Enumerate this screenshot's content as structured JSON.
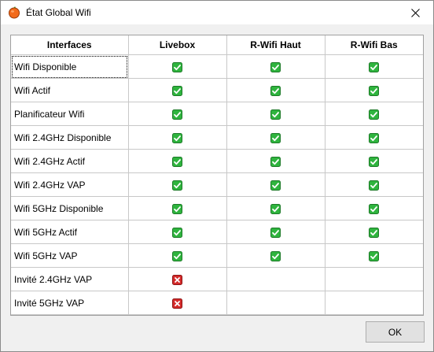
{
  "window": {
    "title": "État Global Wifi",
    "app_icon": "orange-app-icon",
    "close_icon": "close-icon"
  },
  "table": {
    "headers": [
      "Interfaces",
      "Livebox",
      "R-Wifi Haut",
      "R-Wifi Bas"
    ],
    "rows": [
      {
        "label": "Wifi Disponible",
        "values": [
          "ok",
          "ok",
          "ok"
        ]
      },
      {
        "label": "Wifi Actif",
        "values": [
          "ok",
          "ok",
          "ok"
        ]
      },
      {
        "label": "Planificateur Wifi",
        "values": [
          "ok",
          "ok",
          "ok"
        ]
      },
      {
        "label": "Wifi 2.4GHz Disponible",
        "values": [
          "ok",
          "ok",
          "ok"
        ]
      },
      {
        "label": "Wifi 2.4GHz Actif",
        "values": [
          "ok",
          "ok",
          "ok"
        ]
      },
      {
        "label": "Wifi 2.4GHz VAP",
        "values": [
          "ok",
          "ok",
          "ok"
        ]
      },
      {
        "label": "Wifi 5GHz Disponible",
        "values": [
          "ok",
          "ok",
          "ok"
        ]
      },
      {
        "label": "Wifi 5GHz Actif",
        "values": [
          "ok",
          "ok",
          "ok"
        ]
      },
      {
        "label": "Wifi 5GHz VAP",
        "values": [
          "ok",
          "ok",
          "ok"
        ]
      },
      {
        "label": "Invité 2.4GHz VAP",
        "values": [
          "error",
          "",
          ""
        ]
      },
      {
        "label": "Invité 5GHz VAP",
        "values": [
          "error",
          "",
          ""
        ]
      }
    ],
    "status_icons": {
      "ok": "green-check-icon",
      "error": "red-x-icon"
    },
    "colors": {
      "ok": "#2fb43e",
      "error": "#d42b2b"
    }
  },
  "buttons": {
    "ok_label": "OK"
  }
}
